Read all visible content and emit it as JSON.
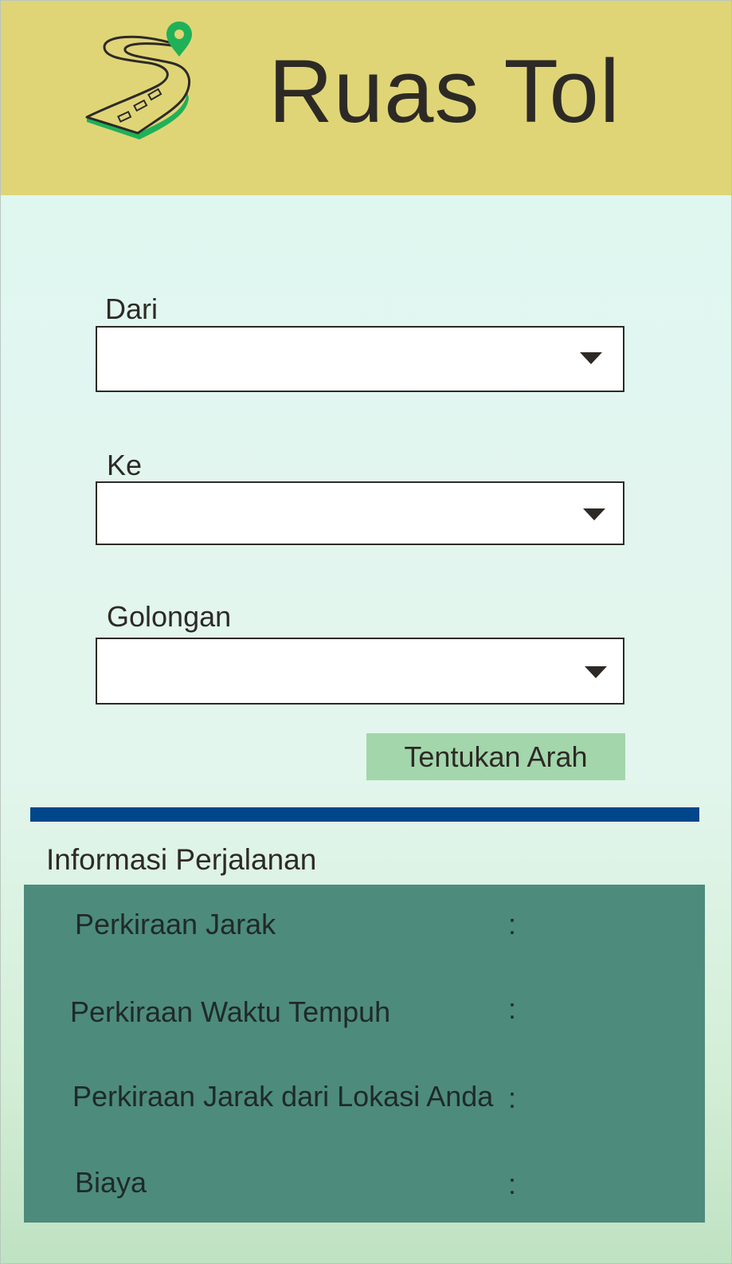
{
  "header": {
    "title": "Ruas Tol",
    "logo_icon": "winding-road-location-pin-icon"
  },
  "form": {
    "from": {
      "label": "Dari",
      "selected": ""
    },
    "to": {
      "label": "Ke",
      "selected": ""
    },
    "class": {
      "label": "Golongan",
      "selected": ""
    },
    "submit_label": "Tentukan Arah"
  },
  "trip_info": {
    "title": "Informasi Perjalanan",
    "rows": [
      {
        "label": "Perkiraan Jarak",
        "separator": ":",
        "value": ""
      },
      {
        "label": "Perkiraan Waktu Tempuh",
        "separator": ":",
        "value": ""
      },
      {
        "label": "Perkiraan Jarak dari Lokasi Anda",
        "separator": ":",
        "value": ""
      },
      {
        "label": "Biaya",
        "separator": ":",
        "value": ""
      }
    ]
  },
  "colors": {
    "header_bg": "#dfd577",
    "page_bg": "#dff7f1",
    "button_bg": "#a3d6ab",
    "divider": "#00468b",
    "panel_bg": "#4d8b7d",
    "logo_green": "#1fb158"
  }
}
